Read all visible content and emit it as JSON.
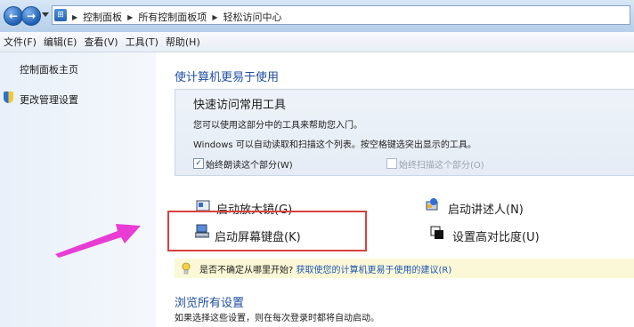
{
  "breadcrumbs": [
    "控制面板",
    "所有控制面板项",
    "轻松访问中心"
  ],
  "menubar": [
    "文件(F)",
    "编辑(E)",
    "查看(V)",
    "工具(T)",
    "帮助(H)"
  ],
  "sidebar": {
    "home": "控制面板主页",
    "admin": "更改管理设置"
  },
  "main": {
    "title": "使计算机更易于使用",
    "quick_access": {
      "title": "快速访问常用工具",
      "desc1": "您可以使用这部分中的工具来帮助您入门。",
      "desc2": "Windows 可以自动读取和扫描这个列表。按空格键选突出显示的工具。",
      "always_read": "始终朗读这个部分(W)",
      "always_scan": "始终扫描这个部分(O)"
    },
    "tools": {
      "magnifier": "启动放大镜(G)",
      "narrator": "启动讲述人(N)",
      "osk": "启动屏幕键盘(K)",
      "contrast": "设置高对比度(U)"
    },
    "tip": {
      "prefix": "是否不确定从哪里开始?",
      "link": "获取使您的计算机更易于使用的建议(R)"
    },
    "browse": {
      "title": "浏览所有设置",
      "desc": "如果选择这些设置，则在每次登录时都将自动启动。"
    }
  },
  "colors": {
    "link_blue": "#1f4fa1",
    "highlight_red": "#d9413f",
    "arrow_magenta": "#e83cd4",
    "tip_bg": "#fbf8d7"
  }
}
